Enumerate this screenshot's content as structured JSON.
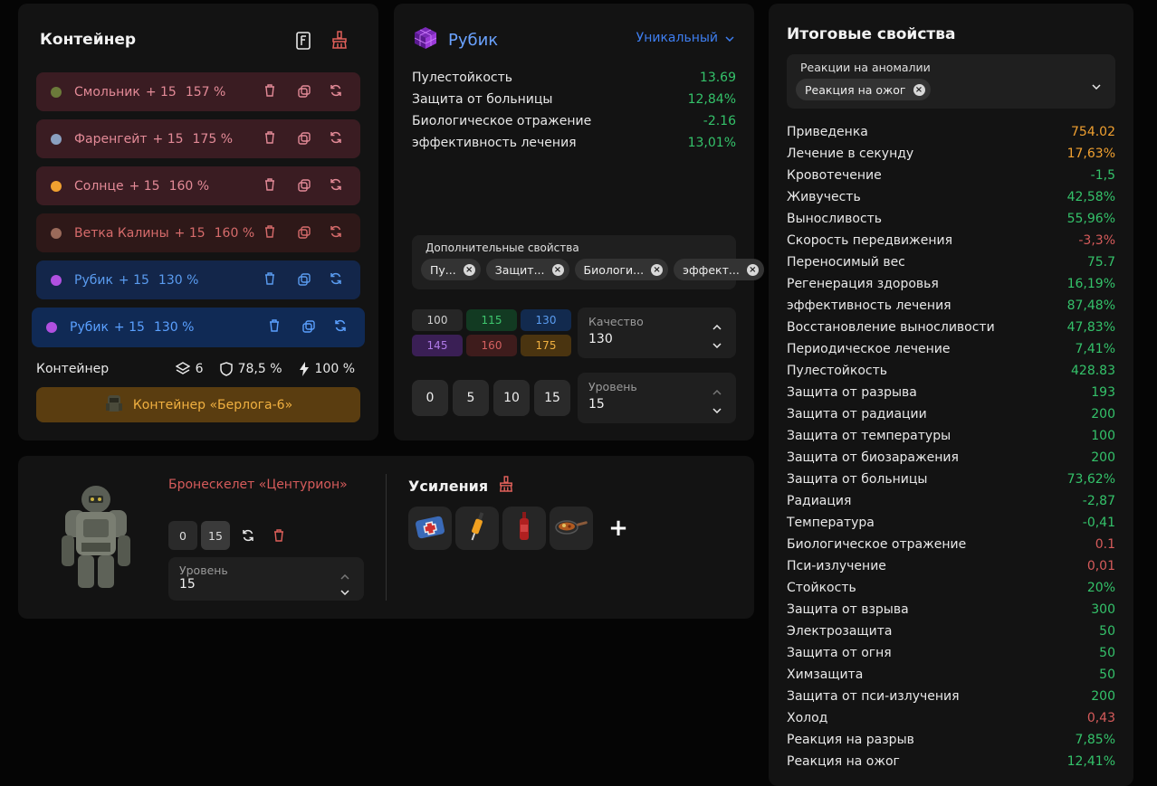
{
  "container_panel": {
    "title": "Контейнер",
    "artifacts": [
      {
        "name": "Смольник",
        "plus": "+ 15",
        "level": "157 %",
        "style": "r-red",
        "icon": "resin-artifact-icon",
        "icon_color": "#6b7a3a"
      },
      {
        "name": "Фаренгейт",
        "plus": "+ 15",
        "level": "175 %",
        "style": "r-red",
        "icon": "fahrenheit-artifact-icon",
        "icon_color": "#8aa0c0"
      },
      {
        "name": "Солнце",
        "plus": "+ 15",
        "level": "160 %",
        "style": "r-red",
        "icon": "sun-artifact-icon",
        "icon_color": "#f0a030"
      },
      {
        "name": "Ветка Калины",
        "plus": "+ 15",
        "level": "160 %",
        "style": "r-red2",
        "icon": "viburnum-artifact-icon",
        "icon_color": "#9a6a5a"
      },
      {
        "name": "Рубик",
        "plus": "+ 15",
        "level": "130 %",
        "style": "r-blue",
        "icon": "rubik-artifact-icon",
        "icon_color": "#b050e0"
      },
      {
        "name": "Рубик",
        "plus": "+ 15",
        "level": "130 %",
        "style": "r-blue2",
        "icon": "rubik-artifact-icon",
        "icon_color": "#b050e0"
      }
    ],
    "summary_label": "Контейнер",
    "slots": "6",
    "protection": "78,5 %",
    "efficiency": "100 %",
    "container_button": "Контейнер «Берлога-6»"
  },
  "artifact_panel": {
    "name": "Рубик",
    "rarity": "Уникальный",
    "properties": [
      {
        "label": "Пулестойкость",
        "value": "13.69",
        "color": "#34c26a"
      },
      {
        "label": "Защита от больницы",
        "value": "12,84%",
        "color": "#34c26a"
      },
      {
        "label": "Биологическое отражение",
        "value": "-2.16",
        "color": "#34c26a"
      },
      {
        "label": "эффективность лечения",
        "value": "13,01%",
        "color": "#34c26a"
      }
    ],
    "extra_label": "Дополнительные свойства",
    "extra_chips": [
      "Пу...",
      "Защит...",
      "Биологи...",
      "эффект..."
    ],
    "quality_grid": [
      {
        "v": "100",
        "bg": "#262626",
        "fg": "#cfcfcf"
      },
      {
        "v": "115",
        "bg": "#123a22",
        "fg": "#3ec76e"
      },
      {
        "v": "130",
        "bg": "#122a4e",
        "fg": "#5a9cf0"
      },
      {
        "v": "145",
        "bg": "#3a1f55",
        "fg": "#b07ae8"
      },
      {
        "v": "160",
        "bg": "#3e1c1c",
        "fg": "#d46060"
      },
      {
        "v": "175",
        "bg": "#4a3410",
        "fg": "#f0b040"
      }
    ],
    "quality_label": "Качество",
    "quality_value": "130",
    "level_buttons": [
      "0",
      "5",
      "10",
      "15"
    ],
    "level_label": "Уровень",
    "level_value": "15"
  },
  "armor_panel": {
    "name": "Бронескелет «Центурион»",
    "lv_buttons": [
      "0",
      "15"
    ],
    "level_label": "Уровень",
    "level_value": "15",
    "boost_title": "Усиления",
    "plus": "+"
  },
  "totals_panel": {
    "title": "Итоговые свойства",
    "reactions_label": "Реакции на аномалии",
    "reaction_chip": "Реакция на ожог",
    "stats": [
      {
        "label": "Приведенка",
        "value": "754.02",
        "color": "#f0a030"
      },
      {
        "label": "Лечение в секунду",
        "value": "17,63%",
        "color": "#f0a030"
      },
      {
        "label": "Кровотечение",
        "value": "-1,5",
        "color": "#34c26a"
      },
      {
        "label": "Живучесть",
        "value": "42,58%",
        "color": "#34c26a"
      },
      {
        "label": "Выносливость",
        "value": "55,96%",
        "color": "#34c26a"
      },
      {
        "label": "Скорость передвижения",
        "value": "-3,3%",
        "color": "#d65b5b"
      },
      {
        "label": "Переносимый вес",
        "value": "75.7",
        "color": "#34c26a"
      },
      {
        "label": "Регенерация здоровья",
        "value": "16,19%",
        "color": "#34c26a"
      },
      {
        "label": "эффективность лечения",
        "value": "87,48%",
        "color": "#34c26a"
      },
      {
        "label": "Восстановление выносливости",
        "value": "47,83%",
        "color": "#34c26a"
      },
      {
        "label": "Периодическое лечение",
        "value": "7,41%",
        "color": "#34c26a"
      },
      {
        "label": "Пулестойкость",
        "value": "428.83",
        "color": "#34c26a"
      },
      {
        "label": "Защита от разрыва",
        "value": "193",
        "color": "#34c26a"
      },
      {
        "label": "Защита от радиации",
        "value": "200",
        "color": "#34c26a"
      },
      {
        "label": "Защита от температуры",
        "value": "100",
        "color": "#34c26a"
      },
      {
        "label": "Защита от биозаражения",
        "value": "200",
        "color": "#34c26a"
      },
      {
        "label": "Защита от больницы",
        "value": "73,62%",
        "color": "#34c26a"
      },
      {
        "label": "Радиация",
        "value": "-2,87",
        "color": "#34c26a"
      },
      {
        "label": "Температура",
        "value": "-0,41",
        "color": "#34c26a"
      },
      {
        "label": "Биологическое отражение",
        "value": "0.1",
        "color": "#d65b5b"
      },
      {
        "label": "Пси-излучение",
        "value": "0,01",
        "color": "#d65b5b"
      },
      {
        "label": "Стойкость",
        "value": "20%",
        "color": "#34c26a"
      },
      {
        "label": "Защита от взрыва",
        "value": "300",
        "color": "#34c26a"
      },
      {
        "label": "Электрозащита",
        "value": "50",
        "color": "#34c26a"
      },
      {
        "label": "Защита от огня",
        "value": "50",
        "color": "#34c26a"
      },
      {
        "label": "Химзащита",
        "value": "50",
        "color": "#34c26a"
      },
      {
        "label": "Защита от пси-излучения",
        "value": "200",
        "color": "#34c26a"
      },
      {
        "label": "Холод",
        "value": "0,43",
        "color": "#d65b5b"
      },
      {
        "label": "Реакция на разрыв",
        "value": "7,85%",
        "color": "#34c26a"
      },
      {
        "label": "Реакция на ожог",
        "value": "12,41%",
        "color": "#34c26a"
      }
    ]
  }
}
